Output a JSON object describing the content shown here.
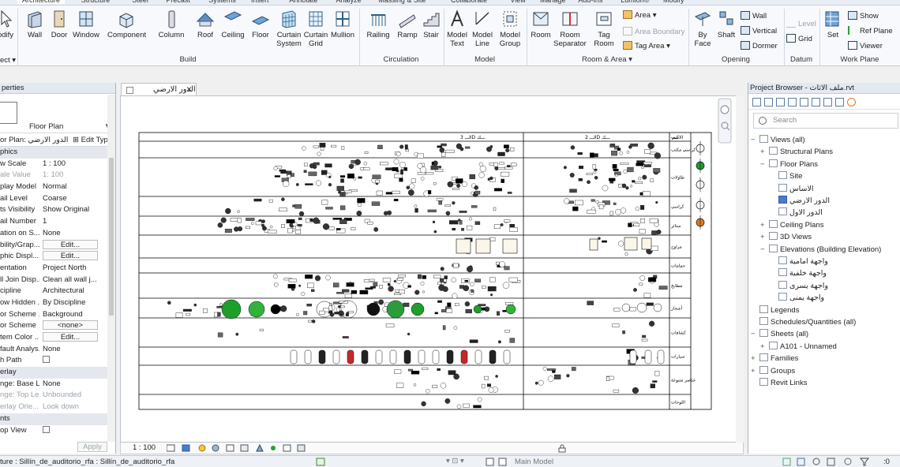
{
  "ribbon": {
    "tabs": [
      "Architecture",
      "Structure",
      "Steel",
      "Precast",
      "Systems",
      "Insert",
      "Annotate",
      "Analyze",
      "Massing & Site",
      "Collaborate",
      "View",
      "Manage",
      "Add-Ins",
      "Lumion®",
      "Modify"
    ],
    "modify_label": "odify",
    "select_label": "ect ▾",
    "build": {
      "label": "Build",
      "wall": "Wall",
      "door": "Door",
      "window": "Window",
      "component": "Component",
      "column": "Column",
      "roof": "Roof",
      "ceiling": "Ceiling",
      "floor": "Floor",
      "curtain_system_1": "Curtain",
      "curtain_system_2": "System",
      "curtain_grid_1": "Curtain",
      "curtain_grid_2": "Grid",
      "mullion": "Mullion"
    },
    "circulation": {
      "label": "Circulation",
      "railing": "Railing",
      "ramp": "Ramp",
      "stair": "Stair"
    },
    "model": {
      "label": "Model",
      "model_text_1": "Model",
      "model_text_2": "Text",
      "model_line_1": "Model",
      "model_line_2": "Line",
      "model_group_1": "Model",
      "model_group_2": "Group"
    },
    "room_area": {
      "label": "Room & Area ▾",
      "room": "Room",
      "room_separator_1": "Room",
      "room_separator_2": "Separator",
      "tag_room_1": "Tag",
      "tag_room_2": "Room",
      "area": "Area ▾",
      "area_boundary": "Area Boundary",
      "tag_area": "Tag Area ▾"
    },
    "opening": {
      "label": "Opening",
      "by_face_1": "By",
      "by_face_2": "Face",
      "shaft": "Shaft",
      "wall": "Wall",
      "vertical": "Vertical",
      "dormer": "Dormer"
    },
    "datum": {
      "label": "Datum",
      "level": "Level",
      "grid": "Grid"
    },
    "work_plane": {
      "label": "Work Plane",
      "set": "Set",
      "show": "Show",
      "ref_plane": "Ref Plane",
      "viewer": "Viewer"
    }
  },
  "properties": {
    "title": "perties",
    "type_name": "Floor Plan",
    "instance_label": "or Plan: الدور الارضي",
    "edit_type": "Edit Type",
    "rows": [
      {
        "k": "phics",
        "v": "",
        "group": true
      },
      {
        "k": "w Scale",
        "v": "1 : 100"
      },
      {
        "k": "ale Value",
        "v": "1: 100",
        "disabled": true
      },
      {
        "k": "play Model",
        "v": "Normal"
      },
      {
        "k": "ail Level",
        "v": "Coarse"
      },
      {
        "k": "ts Visibility",
        "v": "Show Original"
      },
      {
        "k": "ail Number",
        "v": "1"
      },
      {
        "k": "ation on S...",
        "v": "None"
      },
      {
        "k": "bility/Grap...",
        "v": "Edit...",
        "button": true
      },
      {
        "k": "phic Displ...",
        "v": "Edit...",
        "button": true
      },
      {
        "k": "entation",
        "v": "Project North"
      },
      {
        "k": "ll Join Disp...",
        "v": "Clean all wall j..."
      },
      {
        "k": "cipline",
        "v": "Architectural"
      },
      {
        "k": "ow Hidden ...",
        "v": "By Discipline"
      },
      {
        "k": "or Scheme ...",
        "v": "Background"
      },
      {
        "k": "or Scheme",
        "v": "<none>",
        "button": true
      },
      {
        "k": "tem Color ...",
        "v": "Edit...",
        "button": true
      },
      {
        "k": "fault Analys...",
        "v": "None"
      },
      {
        "k": "h Path",
        "v": "",
        "check": true
      },
      {
        "k": "erlay",
        "v": "",
        "group": true
      },
      {
        "k": "nge: Base L...",
        "v": "None"
      },
      {
        "k": "nge: Top Le...",
        "v": "Unbounded",
        "disabled": true
      },
      {
        "k": "erlay Orie...",
        "v": "Look down",
        "disabled": true
      },
      {
        "k": "nts",
        "v": "",
        "group": true
      },
      {
        "k": "op View",
        "v": "",
        "check": true
      }
    ],
    "apply": "Apply"
  },
  "view": {
    "tab_title": "الدور الارضي",
    "scale": "1 : 100",
    "sheet": {
      "header_3d": "الـــ 3D ـــك",
      "header_2d": "الـــ 2D ـــك",
      "header_name": "الاسم",
      "rows": [
        "كنب",
        "كراسي مكتب",
        "طاولات",
        "كراسي",
        "ستائر",
        "مراوح",
        "حمامات",
        "مطابخ",
        "أشجار",
        "كشافات",
        "سيارات",
        "عناصر متنوعة",
        "اللوحات"
      ]
    }
  },
  "browser": {
    "title": "Project Browser - ملف الاثاث.rvt",
    "search_placeholder": "Search",
    "items": [
      {
        "label": "Views (all)",
        "toggle": "−",
        "depth": 0
      },
      {
        "label": "Structural Plans",
        "toggle": "+",
        "depth": 1
      },
      {
        "label": "Floor Plans",
        "toggle": "−",
        "depth": 1
      },
      {
        "label": "Site",
        "toggle": "",
        "depth": 2
      },
      {
        "label": "الاساس",
        "toggle": "",
        "depth": 2
      },
      {
        "label": "الدور الارضي",
        "toggle": "",
        "depth": 2,
        "selected": true
      },
      {
        "label": "الدور الاول",
        "toggle": "",
        "depth": 2
      },
      {
        "label": "Ceiling Plans",
        "toggle": "+",
        "depth": 1
      },
      {
        "label": "3D Views",
        "toggle": "+",
        "depth": 1
      },
      {
        "label": "Elevations (Building Elevation)",
        "toggle": "−",
        "depth": 1
      },
      {
        "label": "واجهة امامية",
        "toggle": "",
        "depth": 2
      },
      {
        "label": "واجهة خلفية",
        "toggle": "",
        "depth": 2
      },
      {
        "label": "واجهة يسرى",
        "toggle": "",
        "depth": 2
      },
      {
        "label": "واجهة يمنى",
        "toggle": "",
        "depth": 2
      },
      {
        "label": "Legends",
        "toggle": "",
        "depth": 0
      },
      {
        "label": "Schedules/Quantities (all)",
        "toggle": "",
        "depth": 0
      },
      {
        "label": "Sheets (all)",
        "toggle": "−",
        "depth": 0
      },
      {
        "label": "A101 - Unnamed",
        "toggle": "+",
        "depth": 1
      },
      {
        "label": "Families",
        "toggle": "+",
        "depth": 0
      },
      {
        "label": "Groups",
        "toggle": "+",
        "depth": 0
      },
      {
        "label": "Revit Links",
        "toggle": "",
        "depth": 0
      }
    ]
  },
  "status": {
    "text": "ture : Sillín_de_auditorio_rfa : Sillín_de_auditorio_rfa",
    "main_model": "Main Model"
  },
  "colors": {
    "accent": "#2f6db5",
    "selected": "#4c7cc8",
    "ribbon_bg": "#f7f9fc"
  }
}
